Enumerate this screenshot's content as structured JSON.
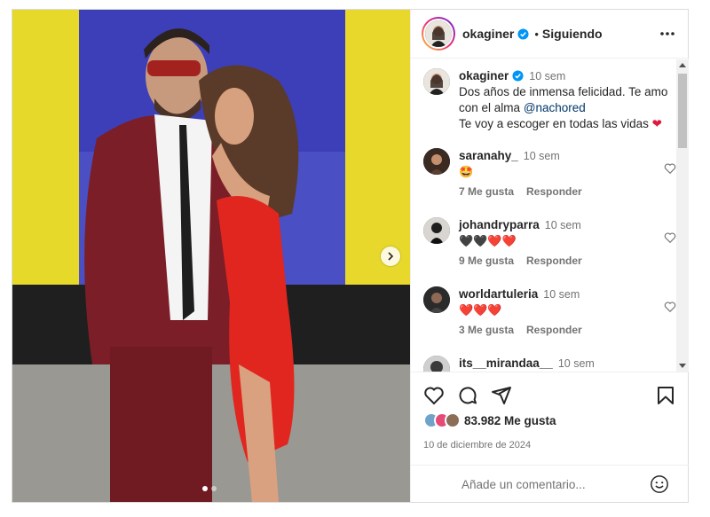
{
  "post": {
    "author": "okaginer",
    "follow_status": "Siguiendo",
    "separator": "•"
  },
  "caption": {
    "username": "okaginer",
    "time": "10 sem",
    "line1": "Dos años de inmensa felicidad. Te amo con el alma",
    "mention": "@nachored",
    "line2": "Te voy a escoger en todas las vidas"
  },
  "comments": [
    {
      "username": "saranahy_",
      "time": "10 sem",
      "text": "🤩",
      "likes": "7 Me gusta",
      "reply": "Responder"
    },
    {
      "username": "johandryparra",
      "time": "10 sem",
      "text": "🖤🖤❤️❤️",
      "likes": "9 Me gusta",
      "reply": "Responder"
    },
    {
      "username": "worldartuleria",
      "time": "10 sem",
      "text": "❤️❤️❤️",
      "likes": "3 Me gusta",
      "reply": "Responder"
    },
    {
      "username": "its__mirandaa__",
      "time": "10 sem",
      "text": "",
      "likes": "",
      "reply": ""
    }
  ],
  "stats": {
    "likes": "83.982 Me gusta",
    "date": "10 de diciembre de 2024"
  },
  "composer": {
    "placeholder": "Añade un comentario..."
  },
  "icons": {
    "like": "heart-icon",
    "comment": "comment-bubble-icon",
    "share": "paper-plane-icon",
    "save": "bookmark-icon",
    "more": "more-dots-icon",
    "next": "chevron-right-icon",
    "emoji": "emoji-smiley-icon",
    "verified": "verified-badge-icon"
  },
  "colors": {
    "verified": "#0095f6",
    "mention": "#00376b",
    "heart": "#e0193e",
    "muted": "#737373"
  },
  "carousel": {
    "slides": 2,
    "current": 1
  }
}
